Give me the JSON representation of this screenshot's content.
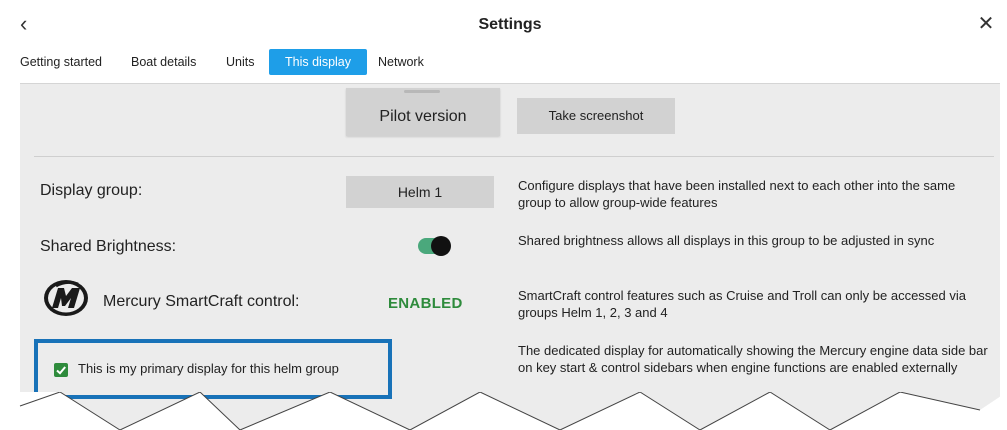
{
  "header": {
    "title": "Settings",
    "back_icon": "‹",
    "close_icon": "✕"
  },
  "tabs": [
    {
      "label": "Getting started",
      "active": false
    },
    {
      "label": "Boat details",
      "active": false
    },
    {
      "label": "Units",
      "active": false
    },
    {
      "label": "This display",
      "active": true
    },
    {
      "label": "Network",
      "active": false
    }
  ],
  "actions": {
    "pilot_version": "Pilot version",
    "take_screenshot": "Take screenshot"
  },
  "settings": {
    "display_group": {
      "label": "Display group:",
      "value": "Helm 1",
      "description": "Configure displays that have been installed next to each other into the same group to allow group-wide features"
    },
    "shared_brightness": {
      "label": "Shared Brightness:",
      "enabled": true,
      "description": "Shared brightness allows all displays in this group to be adjusted in sync"
    },
    "smartcraft": {
      "label": "Mercury SmartCraft control:",
      "status": "ENABLED",
      "description": "SmartCraft control features such as Cruise and Troll can only be accessed via groups Helm 1, 2, 3 and 4"
    },
    "primary_display": {
      "label": "This is my primary display for this helm group",
      "checked": true,
      "description": "The dedicated display for automatically showing the Mercury engine data side bar on key start & control sidebars when engine functions are enabled externally"
    }
  },
  "colors": {
    "accent": "#1e9ee8",
    "highlight_border": "#1872b8",
    "enabled_text": "#2e8b3c",
    "toggle_on": "#4aa87c",
    "panel_bg": "#ececec"
  }
}
